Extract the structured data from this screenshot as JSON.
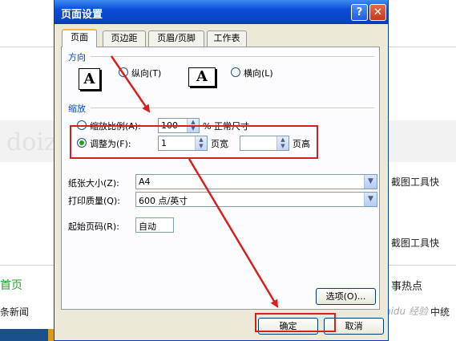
{
  "background": {
    "right_items": [
      "截图工具快",
      "截图工具快",
      "事热点",
      "中统"
    ],
    "left_items": [
      "首页",
      "条新闻"
    ],
    "watermark": "Baidu 经验"
  },
  "dialog": {
    "title": "页面设置",
    "help_label": "?",
    "close_label": "✕",
    "tabs": [
      {
        "label": "页面",
        "active": true
      },
      {
        "label": "页边距",
        "active": false
      },
      {
        "label": "页眉/页脚",
        "active": false
      },
      {
        "label": "工作表",
        "active": false
      }
    ],
    "orientation": {
      "group_label": "方向",
      "portrait_glyph": "A",
      "landscape_glyph": "A",
      "portrait_label": "纵向(T)",
      "portrait_selected": false,
      "landscape_label": "横向(L)",
      "landscape_selected": false
    },
    "scaling": {
      "group_label": "缩放",
      "adjust_label": "缩放比例(A):",
      "adjust_value": "100",
      "adjust_suffix": "% 正常尺寸",
      "fit_label": "调整为(F):",
      "fit_selected": true,
      "fit_wide_value": "1",
      "fit_wide_suffix": "页宽",
      "fit_tall_value": "",
      "fit_tall_suffix": "页高"
    },
    "paper_size": {
      "label": "纸张大小(Z):",
      "value": "A4"
    },
    "print_quality": {
      "label": "打印质量(Q):",
      "value": "600 点/英寸"
    },
    "first_page": {
      "label": "起始页码(R):",
      "value": "自动"
    },
    "options_label": "选项(O)...",
    "ok_label": "确定",
    "cancel_label": "取消"
  },
  "colors": {
    "annotation": "#d81e1e",
    "group_label": "#0046d5",
    "titlebar": "#0a4cd8"
  }
}
